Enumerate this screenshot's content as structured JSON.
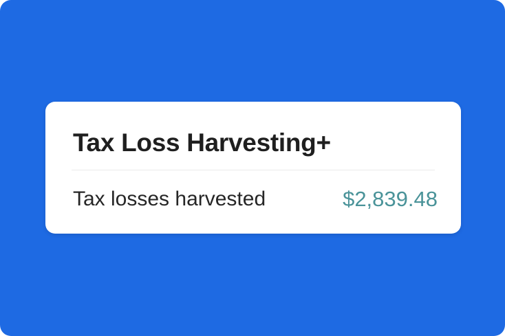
{
  "colors": {
    "background": "#1e6ae3",
    "card": "#ffffff",
    "title_text": "#1f1f1f",
    "label_text": "#262626",
    "value_accent": "#4a9399"
  },
  "card": {
    "title": "Tax Loss Harvesting+",
    "row": {
      "label": "Tax losses harvested",
      "value": "$2,839.48"
    }
  }
}
